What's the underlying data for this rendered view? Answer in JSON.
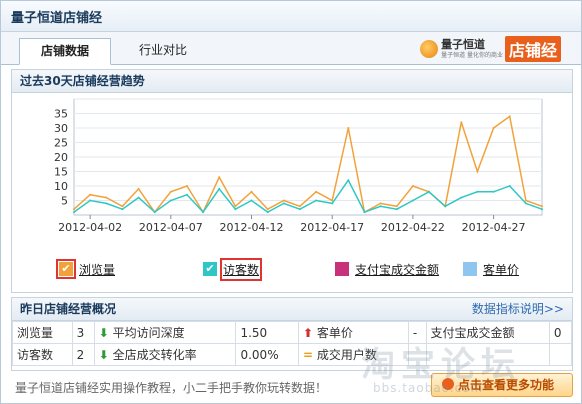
{
  "window": {
    "title": "量子恒道店铺经"
  },
  "tabs": [
    {
      "label": "店铺数据",
      "active": true
    },
    {
      "label": "行业对比",
      "active": false
    }
  ],
  "logo": {
    "name": "量子恒道",
    "sub": "量子恒道 量化你的商业",
    "badge": "店铺经"
  },
  "trend_panel": {
    "title": "过去30天店铺经营趋势"
  },
  "chart_data": {
    "type": "line",
    "x_ticks": [
      "2012-04-02",
      "2012-04-07",
      "2012-04-12",
      "2012-04-17",
      "2012-04-22",
      "2012-04-27"
    ],
    "x": [
      "2012-04-01",
      "2012-04-02",
      "2012-04-03",
      "2012-04-04",
      "2012-04-05",
      "2012-04-06",
      "2012-04-07",
      "2012-04-08",
      "2012-04-09",
      "2012-04-10",
      "2012-04-11",
      "2012-04-12",
      "2012-04-13",
      "2012-04-14",
      "2012-04-15",
      "2012-04-16",
      "2012-04-17",
      "2012-04-18",
      "2012-04-19",
      "2012-04-20",
      "2012-04-21",
      "2012-04-22",
      "2012-04-23",
      "2012-04-24",
      "2012-04-25",
      "2012-04-26",
      "2012-04-27",
      "2012-04-28",
      "2012-04-29",
      "2012-04-30"
    ],
    "ylim": [
      0,
      40
    ],
    "y_ticks": [
      5,
      10,
      15,
      20,
      25,
      30,
      35,
      40
    ],
    "grid": true,
    "series": [
      {
        "name": "浏览量",
        "color": "#f2a23a",
        "values": [
          2,
          7,
          6,
          3,
          9,
          1,
          8,
          10,
          1,
          13,
          3,
          8,
          2,
          5,
          3,
          8,
          5,
          30,
          1,
          4,
          3,
          10,
          8,
          3,
          32,
          15,
          30,
          34,
          5,
          3
        ]
      },
      {
        "name": "访客数",
        "color": "#2fc7c5",
        "values": [
          1,
          5,
          4,
          2,
          6,
          1,
          5,
          7,
          1,
          9,
          2,
          5,
          1,
          4,
          2,
          5,
          4,
          12,
          1,
          3,
          2,
          5,
          8,
          3,
          6,
          8,
          8,
          10,
          4,
          2
        ]
      }
    ]
  },
  "legend": [
    {
      "label": "浏览量",
      "color": "#f2a23a",
      "checked": true
    },
    {
      "label": "访客数",
      "color": "#2fc7c5",
      "checked": true
    },
    {
      "label": "支付宝成交金额",
      "color": "#c8327a",
      "checked": false
    },
    {
      "label": "客单价",
      "color": "#8fc6f0",
      "checked": false
    }
  ],
  "summary_panel": {
    "title": "昨日店铺经营概况",
    "help_link": "数据指标说明>>",
    "rows": [
      {
        "c1": "浏览量",
        "c2": "3",
        "c3": "平均访问深度",
        "c4": "1.50",
        "c5": "客单价",
        "c6": "-",
        "c7": "支付宝成交金额",
        "c8": "0"
      },
      {
        "c1": "访客数",
        "c2": "2",
        "c3": "全店成交转化率",
        "c4": "0.00%",
        "c5": "成交用户数",
        "c6": "",
        "c7": "",
        "c8": ""
      }
    ]
  },
  "footer": {
    "text": "量子恒道店铺经实用操作教程，小二手把手教你玩转数据！",
    "button": "点击查看更多功能"
  },
  "watermark": {
    "text": "淘宝论坛",
    "url": "bbs.taobao.com"
  }
}
